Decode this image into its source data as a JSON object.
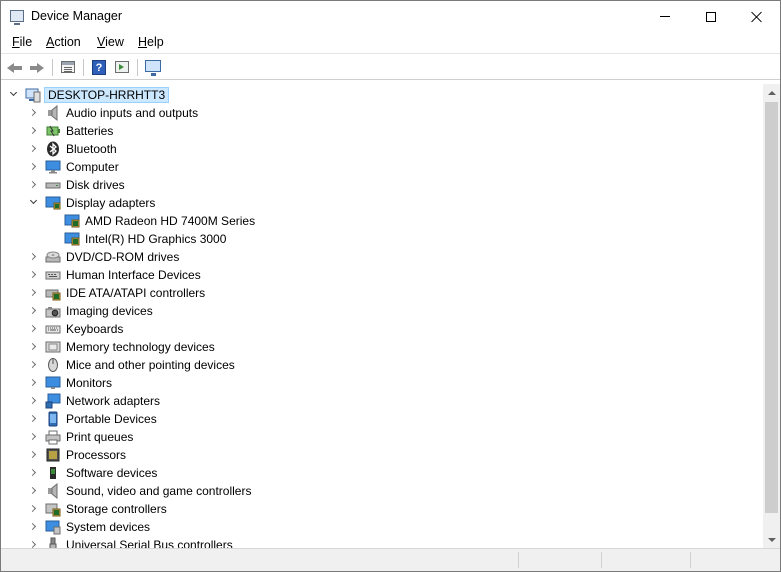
{
  "window": {
    "title": "Device Manager"
  },
  "menu": [
    {
      "key": "F",
      "rest": "ile"
    },
    {
      "key": "A",
      "rest": "ction"
    },
    {
      "key": "V",
      "rest": "iew"
    },
    {
      "key": "H",
      "rest": "elp"
    }
  ],
  "toolbar": {
    "icons": [
      "back-arrow-icon",
      "forward-arrow-icon",
      "properties-icon",
      "help-icon",
      "update-driver-icon",
      "scan-hardware-icon"
    ]
  },
  "tree": {
    "root": "DESKTOP-HRRHTT3",
    "categories": [
      {
        "label": "Audio inputs and outputs",
        "icon": "speaker-icon",
        "expanded": false
      },
      {
        "label": "Batteries",
        "icon": "battery-icon",
        "expanded": false
      },
      {
        "label": "Bluetooth",
        "icon": "bluetooth-icon",
        "expanded": false
      },
      {
        "label": "Computer",
        "icon": "computer-icon",
        "expanded": false
      },
      {
        "label": "Disk drives",
        "icon": "disk-drive-icon",
        "expanded": false
      },
      {
        "label": "Display adapters",
        "icon": "display-adapter-icon",
        "expanded": true,
        "children": [
          "AMD Radeon HD 7400M Series",
          "Intel(R) HD Graphics 3000"
        ]
      },
      {
        "label": "DVD/CD-ROM drives",
        "icon": "dvd-drive-icon",
        "expanded": false
      },
      {
        "label": "Human Interface Devices",
        "icon": "hid-icon",
        "expanded": false
      },
      {
        "label": "IDE ATA/ATAPI controllers",
        "icon": "ide-controller-icon",
        "expanded": false
      },
      {
        "label": "Imaging devices",
        "icon": "camera-icon",
        "expanded": false
      },
      {
        "label": "Keyboards",
        "icon": "keyboard-icon",
        "expanded": false
      },
      {
        "label": "Memory technology devices",
        "icon": "memory-icon",
        "expanded": false
      },
      {
        "label": "Mice and other pointing devices",
        "icon": "mouse-icon",
        "expanded": false
      },
      {
        "label": "Monitors",
        "icon": "monitor-icon",
        "expanded": false
      },
      {
        "label": "Network adapters",
        "icon": "network-adapter-icon",
        "expanded": false
      },
      {
        "label": "Portable Devices",
        "icon": "portable-device-icon",
        "expanded": false
      },
      {
        "label": "Print queues",
        "icon": "printer-icon",
        "expanded": false
      },
      {
        "label": "Processors",
        "icon": "processor-icon",
        "expanded": false
      },
      {
        "label": "Software devices",
        "icon": "software-device-icon",
        "expanded": false
      },
      {
        "label": "Sound, video and game controllers",
        "icon": "sound-controller-icon",
        "expanded": false
      },
      {
        "label": "Storage controllers",
        "icon": "storage-controller-icon",
        "expanded": false
      },
      {
        "label": "System devices",
        "icon": "system-device-icon",
        "expanded": false
      },
      {
        "label": "Universal Serial Bus controllers",
        "icon": "usb-icon",
        "expanded": false
      }
    ]
  }
}
